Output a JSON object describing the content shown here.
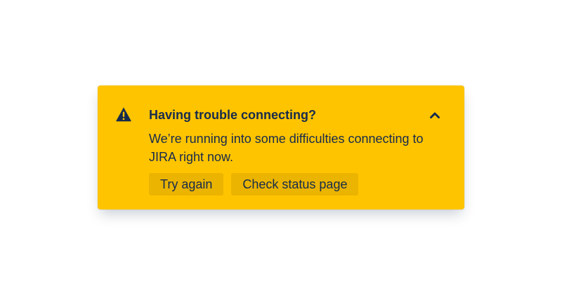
{
  "colors": {
    "flag_background": "#FFC400",
    "button_background": "#EBB400",
    "text": "#172B4D"
  },
  "flag": {
    "icon": "warning-icon",
    "title": "Having trouble connecting?",
    "description": "We’re running into some difficulties connecting to JIRA right now.",
    "collapse_icon": "chevron-up-icon",
    "actions": [
      {
        "label": "Try again"
      },
      {
        "label": "Check status page"
      }
    ]
  }
}
